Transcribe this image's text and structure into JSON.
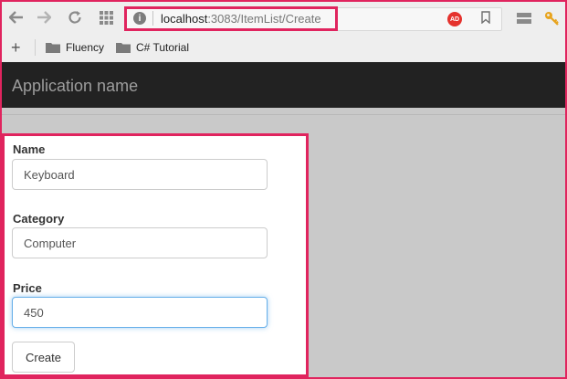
{
  "browser": {
    "url_host": "localhost",
    "url_path": ":3083/ItemList/Create",
    "info_icon_label": "i",
    "adblock_label": "AD"
  },
  "bookmarks": {
    "add_label": "+",
    "items": [
      {
        "label": "Fluency",
        "icon": "folder-icon"
      },
      {
        "label": "C# Tutorial",
        "icon": "folder-icon"
      }
    ]
  },
  "navbar": {
    "app_name": "Application name",
    "background": "#222222"
  },
  "form": {
    "fields": [
      {
        "label": "Name",
        "value": "Keyboard"
      },
      {
        "label": "Category",
        "value": "Computer"
      },
      {
        "label": "Price",
        "value": "450"
      }
    ],
    "submit_label": "Create"
  },
  "colors": {
    "highlight": "#e0245e",
    "focus": "#66afe9"
  }
}
